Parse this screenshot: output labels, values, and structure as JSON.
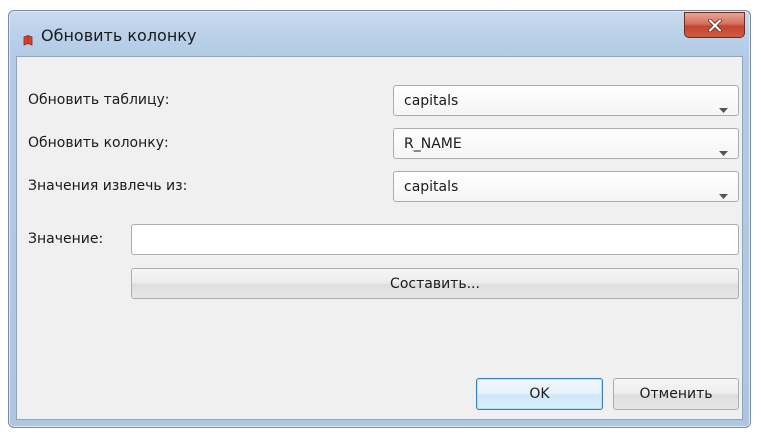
{
  "window": {
    "title": "Обновить колонку",
    "close_icon": "close-icon"
  },
  "form": {
    "update_table": {
      "label": "Обновить таблицу:",
      "value": "capitals"
    },
    "update_column": {
      "label": "Обновить колонку:",
      "value": "R_NAME"
    },
    "values_from": {
      "label": "Значения извлечь из:",
      "value": "capitals"
    },
    "value_field": {
      "label": "Значение:",
      "value": ""
    },
    "compose_button_label": "Составить..."
  },
  "footer": {
    "ok_label": "OK",
    "cancel_label": "Отменить"
  },
  "colors": {
    "title_bar": "#bcd2ea",
    "close_button": "#c2472f",
    "client_background": "#f0f0f0",
    "default_button_border": "#3c7fb1"
  }
}
